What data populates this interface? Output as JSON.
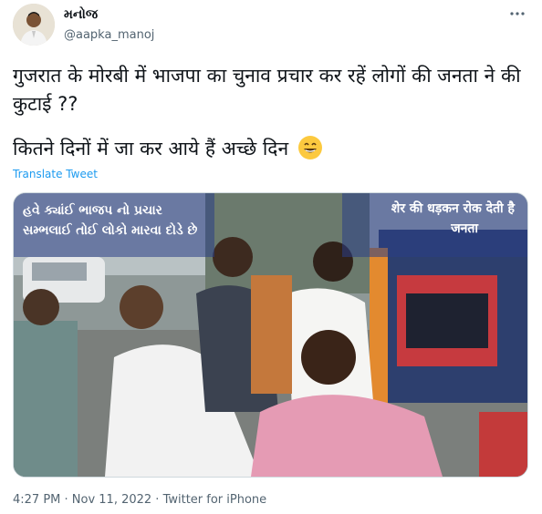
{
  "user": {
    "name": "મનોજ",
    "handle": "@aapka_manoj"
  },
  "more_icon": "more-horizontal-icon",
  "tweet": {
    "line1": "गुजरात के मोरबी में भाजपा का चुनाव प्रचार कर रहें लोगों की जनता ने की कुटाई ??",
    "line2": "कितने दिनों में जा कर आये हैं अच्छे दिन",
    "emoji": "grinning-face-with-smiling-eyes",
    "translate_label": "Translate Tweet"
  },
  "media": {
    "caption_left": "હવે ક્યાંઈ ભાજપ નો પ્રચાર સમ્ભલાઈ તોઈ લોકો મારવા દોડે છે",
    "caption_right_line1": "शेर की धड़कन रोक देती है",
    "caption_right_line2": "जनता"
  },
  "footer": {
    "time": "4:27 PM",
    "date": "Nov 11, 2022",
    "source": "Twitter for iPhone",
    "full": "4:27 PM · Nov 11, 2022 · Twitter for iPhone"
  },
  "colors": {
    "accent": "#1d9bf0",
    "muted": "#536471",
    "text": "#0f1419"
  }
}
